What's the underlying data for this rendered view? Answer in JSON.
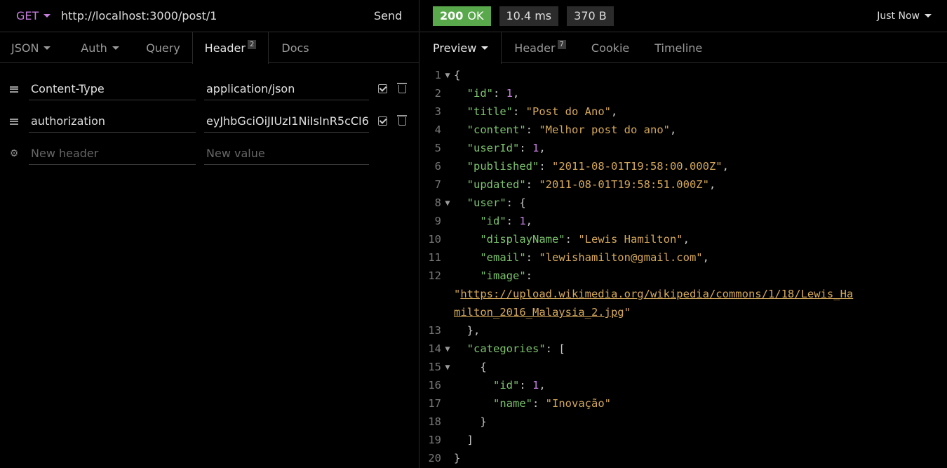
{
  "request": {
    "method": "GET",
    "url": "http://localhost:3000/post/1",
    "send_label": "Send"
  },
  "request_tabs": [
    {
      "label": "JSON"
    },
    {
      "label": "Auth"
    },
    {
      "label": "Query"
    },
    {
      "label": "Header",
      "badge": "2"
    },
    {
      "label": "Docs"
    }
  ],
  "headers": [
    {
      "name": "Content-Type",
      "value": "application/json"
    },
    {
      "name": "authorization",
      "value": "eyJhbGciOiJIUzI1NiIsInR5cCI6"
    }
  ],
  "new_header": {
    "name_placeholder": "New header",
    "value_placeholder": "New value"
  },
  "response": {
    "status_code": "200",
    "status_text": "OK",
    "time": "10.4 ms",
    "size": "370 B",
    "when": "Just Now"
  },
  "response_tabs": [
    {
      "label": "Preview"
    },
    {
      "label": "Header",
      "badge": "7"
    },
    {
      "label": "Cookie"
    },
    {
      "label": "Timeline"
    }
  ],
  "json_lines": [
    {
      "n": "1",
      "fold": "▼",
      "tokens": [
        [
          "p",
          "{"
        ]
      ]
    },
    {
      "n": "2",
      "fold": "",
      "tokens": [
        [
          "p",
          "  "
        ],
        [
          "k",
          "\"id\""
        ],
        [
          "p",
          ": "
        ],
        [
          "n",
          "1"
        ],
        [
          "p",
          ","
        ]
      ]
    },
    {
      "n": "3",
      "fold": "",
      "tokens": [
        [
          "p",
          "  "
        ],
        [
          "k",
          "\"title\""
        ],
        [
          "p",
          ": "
        ],
        [
          "s",
          "\"Post do Ano\""
        ],
        [
          "p",
          ","
        ]
      ]
    },
    {
      "n": "4",
      "fold": "",
      "tokens": [
        [
          "p",
          "  "
        ],
        [
          "k",
          "\"content\""
        ],
        [
          "p",
          ": "
        ],
        [
          "s",
          "\"Melhor post do ano\""
        ],
        [
          "p",
          ","
        ]
      ]
    },
    {
      "n": "5",
      "fold": "",
      "tokens": [
        [
          "p",
          "  "
        ],
        [
          "k",
          "\"userId\""
        ],
        [
          "p",
          ": "
        ],
        [
          "n",
          "1"
        ],
        [
          "p",
          ","
        ]
      ]
    },
    {
      "n": "6",
      "fold": "",
      "tokens": [
        [
          "p",
          "  "
        ],
        [
          "k",
          "\"published\""
        ],
        [
          "p",
          ": "
        ],
        [
          "s",
          "\"2011-08-01T19:58:00.000Z\""
        ],
        [
          "p",
          ","
        ]
      ]
    },
    {
      "n": "7",
      "fold": "",
      "tokens": [
        [
          "p",
          "  "
        ],
        [
          "k",
          "\"updated\""
        ],
        [
          "p",
          ": "
        ],
        [
          "s",
          "\"2011-08-01T19:58:51.000Z\""
        ],
        [
          "p",
          ","
        ]
      ]
    },
    {
      "n": "8",
      "fold": "▼",
      "tokens": [
        [
          "p",
          "  "
        ],
        [
          "k",
          "\"user\""
        ],
        [
          "p",
          ": {"
        ]
      ]
    },
    {
      "n": "9",
      "fold": "",
      "tokens": [
        [
          "p",
          "    "
        ],
        [
          "k",
          "\"id\""
        ],
        [
          "p",
          ": "
        ],
        [
          "n",
          "1"
        ],
        [
          "p",
          ","
        ]
      ]
    },
    {
      "n": "10",
      "fold": "",
      "tokens": [
        [
          "p",
          "    "
        ],
        [
          "k",
          "\"displayName\""
        ],
        [
          "p",
          ": "
        ],
        [
          "s",
          "\"Lewis Hamilton\""
        ],
        [
          "p",
          ","
        ]
      ]
    },
    {
      "n": "11",
      "fold": "",
      "tokens": [
        [
          "p",
          "    "
        ],
        [
          "k",
          "\"email\""
        ],
        [
          "p",
          ": "
        ],
        [
          "s",
          "\"lewishamilton@gmail.com\""
        ],
        [
          "p",
          ","
        ]
      ]
    },
    {
      "n": "12",
      "fold": "",
      "tokens": [
        [
          "p",
          "    "
        ],
        [
          "k",
          "\"image\""
        ],
        [
          "p",
          ":"
        ]
      ]
    },
    {
      "n": "",
      "fold": "",
      "tokens": [
        [
          "s",
          "\""
        ],
        [
          "u",
          "https://upload.wikimedia.org/wikipedia/commons/1/18/Lewis_Ha"
        ]
      ]
    },
    {
      "n": "",
      "fold": "",
      "tokens": [
        [
          "u",
          "milton_2016_Malaysia_2.jpg"
        ],
        [
          "s",
          "\""
        ]
      ]
    },
    {
      "n": "13",
      "fold": "",
      "tokens": [
        [
          "p",
          "  },"
        ]
      ]
    },
    {
      "n": "14",
      "fold": "▼",
      "tokens": [
        [
          "p",
          "  "
        ],
        [
          "k",
          "\"categories\""
        ],
        [
          "p",
          ": ["
        ]
      ]
    },
    {
      "n": "15",
      "fold": "▼",
      "tokens": [
        [
          "p",
          "    {"
        ]
      ]
    },
    {
      "n": "16",
      "fold": "",
      "tokens": [
        [
          "p",
          "      "
        ],
        [
          "k",
          "\"id\""
        ],
        [
          "p",
          ": "
        ],
        [
          "n",
          "1"
        ],
        [
          "p",
          ","
        ]
      ]
    },
    {
      "n": "17",
      "fold": "",
      "tokens": [
        [
          "p",
          "      "
        ],
        [
          "k",
          "\"name\""
        ],
        [
          "p",
          ": "
        ],
        [
          "s",
          "\"Inovação\""
        ]
      ]
    },
    {
      "n": "18",
      "fold": "",
      "tokens": [
        [
          "p",
          "    }"
        ]
      ]
    },
    {
      "n": "19",
      "fold": "",
      "tokens": [
        [
          "p",
          "  ]"
        ]
      ]
    },
    {
      "n": "20",
      "fold": "",
      "tokens": [
        [
          "p",
          "}"
        ]
      ]
    }
  ],
  "colors": {
    "status_ok": "#59a84b",
    "method": "#c67ede",
    "json_key": "#7cc36e",
    "json_string": "#d5a85a",
    "json_number": "#c67ede"
  }
}
